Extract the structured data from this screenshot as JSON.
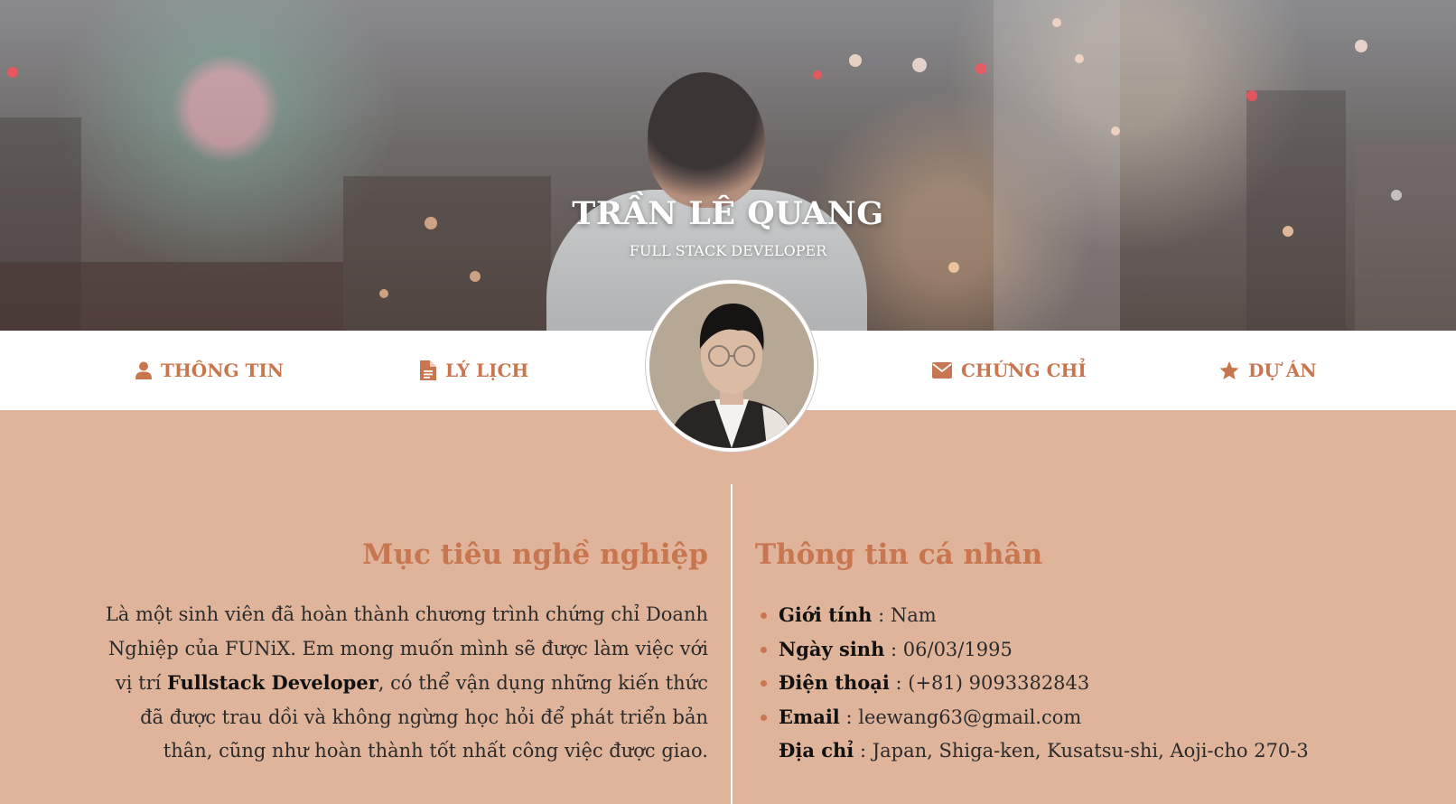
{
  "hero": {
    "name": "TRẦN LÊ QUANG",
    "role": "FULL STACK DEVELOPER"
  },
  "nav": {
    "items": [
      {
        "label": "THÔNG TIN",
        "icon": "user-icon"
      },
      {
        "label": "LÝ LỊCH",
        "icon": "document-icon"
      },
      {
        "label": "CHỨNG CHỈ",
        "icon": "envelope-icon"
      },
      {
        "label": "DỰ ÁN",
        "icon": "star-icon"
      }
    ]
  },
  "career": {
    "title": "Mục tiêu nghề nghiệp",
    "text_1": "Là một sinh viên đã hoàn thành chương trình chứng chỉ Doanh Nghiệp của FUNiX. Em mong muốn mình sẽ được làm việc với vị trí ",
    "highlight": "Fullstack Developer",
    "text_2": ", có thể vận dụng những kiến thức đã được trau dồi và không ngừng học hỏi để phát triển bản thân, cũng như hoàn thành tốt nhất công việc được giao."
  },
  "personal": {
    "title": "Thông tin cá nhân",
    "items": [
      {
        "key": "Giới tính",
        "value": " : Nam"
      },
      {
        "key": "Ngày sinh",
        "value": " : 06/03/1995"
      },
      {
        "key": "Điện thoại",
        "value": " : (+81) 9093382843"
      },
      {
        "key": "Email",
        "value": " : leewang63@gmail.com"
      },
      {
        "key": "Địa chỉ",
        "value": " : Japan, Shiga-ken, Kusatsu-shi, Aoji-cho 270-3"
      }
    ]
  },
  "colors": {
    "accent": "#c8764f",
    "background": "#dfb49b",
    "nav_background": "#ffffff"
  }
}
